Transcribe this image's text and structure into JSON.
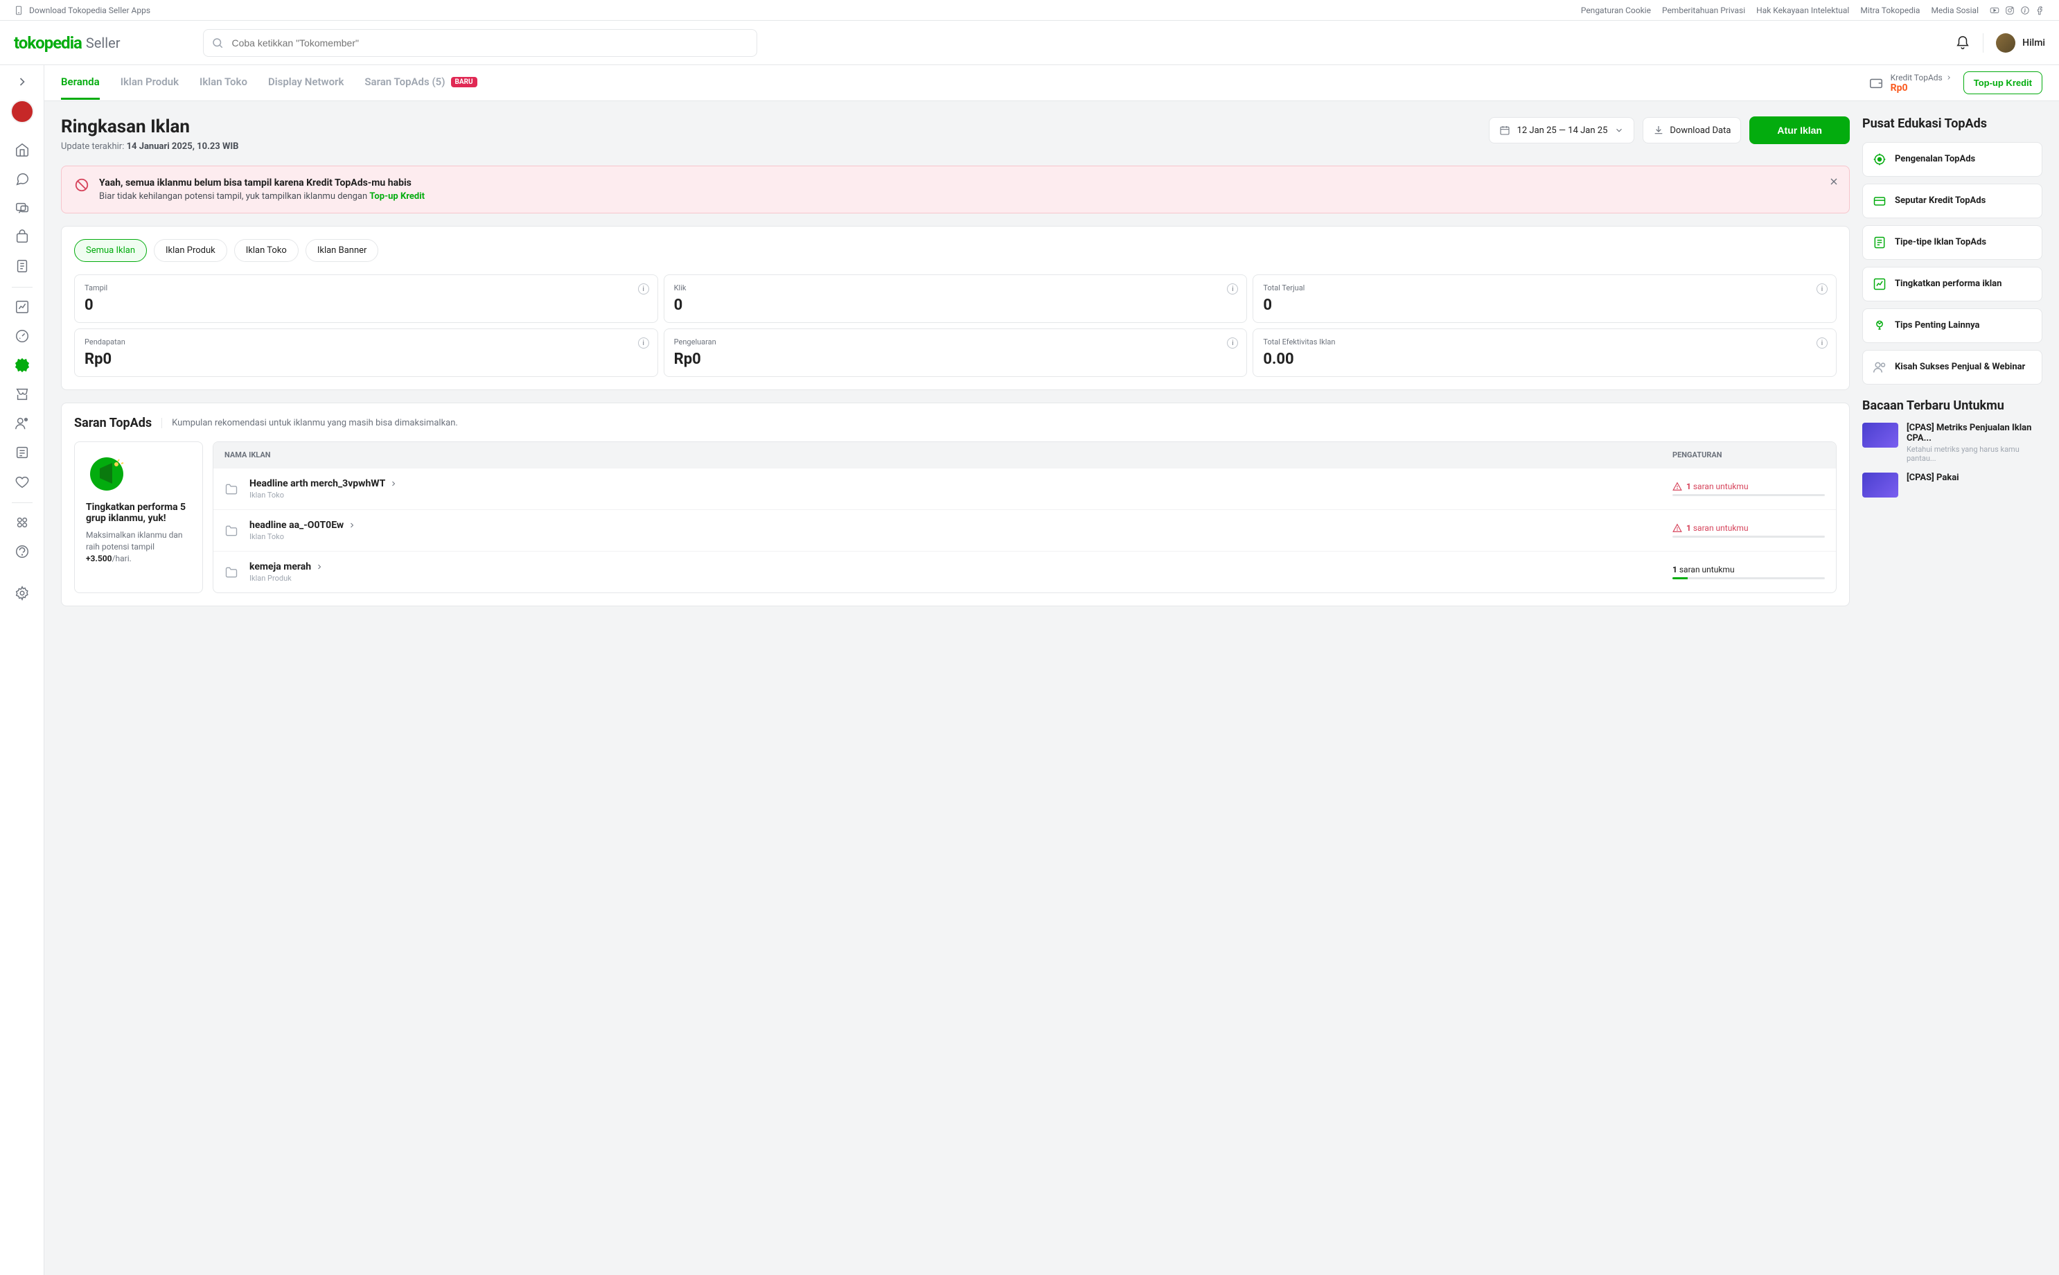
{
  "topbar": {
    "download": "Download Tokopedia Seller Apps",
    "links": [
      "Pengaturan Cookie",
      "Pemberitahuan Privasi",
      "Hak Kekayaan Intelektual",
      "Mitra Tokopedia",
      "Media Sosial"
    ]
  },
  "header": {
    "logo": "tokopedia",
    "logo_sub": "Seller",
    "search_placeholder": "Coba ketikkan \"Tokomember\"",
    "user_name": "Hilmi"
  },
  "tabs": {
    "items": [
      {
        "label": "Beranda",
        "active": true
      },
      {
        "label": "Iklan Produk"
      },
      {
        "label": "Iklan Toko"
      },
      {
        "label": "Display Network"
      },
      {
        "label": "Saran TopAds (5)",
        "badge": "BARU"
      }
    ],
    "kredit_label": "Kredit TopAds",
    "kredit_value": "Rp0",
    "topup": "Top-up Kredit"
  },
  "page": {
    "title": "Ringkasan Iklan",
    "updated_prefix": "Update terakhir: ",
    "updated_value": "14 Januari 2025, 10.23 WIB",
    "date_range": "12 Jan 25 — 14 Jan 25",
    "download": "Download Data",
    "atur": "Atur Iklan"
  },
  "alert": {
    "title": "Yaah, semua iklanmu belum bisa tampil karena Kredit TopAds-mu habis",
    "text": "Biar tidak kehilangan potensi tampil, yuk tampilkan iklanmu dengan ",
    "link": "Top-up Kredit"
  },
  "pills": [
    "Semua Iklan",
    "Iklan Produk",
    "Iklan Toko",
    "Iklan Banner"
  ],
  "stats": [
    {
      "label": "Tampil",
      "value": "0"
    },
    {
      "label": "Klik",
      "value": "0"
    },
    {
      "label": "Total Terjual",
      "value": "0"
    },
    {
      "label": "Pendapatan",
      "value": "Rp0"
    },
    {
      "label": "Pengeluaran",
      "value": "Rp0"
    },
    {
      "label": "Total Efektivitas Iklan",
      "value": "0.00"
    }
  ],
  "saran": {
    "title": "Saran TopAds",
    "sub": "Kumpulan rekomendasi untuk iklanmu yang masih bisa dimaksimalkan.",
    "col_name": "NAMA IKLAN",
    "col_set": "PENGATURAN",
    "promo": {
      "title": "Tingkatkan performa 5 grup iklanmu, yuk!",
      "text_a": "Maksimalkan iklanmu dan raih potensi tampil ",
      "text_b": "+3.500",
      "text_c": "/hari."
    },
    "rows": [
      {
        "title": "Headline arth merch_3vpwhWT",
        "type": "Iklan Toko",
        "note": "1 saran untukmu",
        "warn": true
      },
      {
        "title": "headline aa_-O0T0Ew",
        "type": "Iklan Toko",
        "note": "1 saran untukmu",
        "warn": true
      },
      {
        "title": "kemeja merah",
        "type": "Iklan Produk",
        "note": "1 saran untukmu",
        "warn": false
      }
    ]
  },
  "edu": {
    "title": "Pusat Edukasi TopAds",
    "items": [
      {
        "label": "Pengenalan TopAds",
        "color": "#03ac0e"
      },
      {
        "label": "Seputar Kredit TopAds",
        "color": "#03ac0e"
      },
      {
        "label": "Tipe-tipe Iklan TopAds",
        "color": "#03ac0e"
      },
      {
        "label": "Tingkatkan performa iklan",
        "color": "#03ac0e"
      },
      {
        "label": "Tips Penting Lainnya",
        "color": "#03ac0e"
      },
      {
        "label": "Kisah Sukses Penjual & Webinar",
        "color": "#9fa6b0"
      }
    ]
  },
  "bacaan": {
    "title": "Bacaan Terbaru Untukmu",
    "items": [
      {
        "title": "[CPAS] Metriks Penjualan Iklan CPA...",
        "sub": "Ketahui metriks yang harus kamu pantau..."
      },
      {
        "title": "[CPAS] Pakai",
        "sub": ""
      }
    ]
  }
}
